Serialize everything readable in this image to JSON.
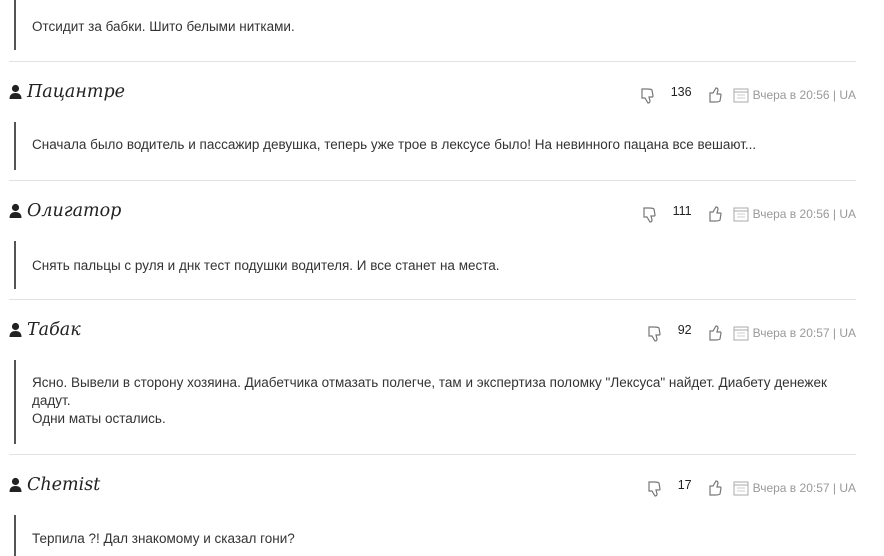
{
  "top_comment": {
    "text": "Отсидит за бабки. Шито белыми нитками."
  },
  "comments": [
    {
      "author": "Пацантре",
      "votes": "136",
      "date": "Вчера в 20:56 | UA",
      "text": [
        "Сначала было водитель и пассажир девушка, теперь уже трое в лексусе было! На невинного пацана все вешают..."
      ]
    },
    {
      "author": "Олигатор",
      "votes": "111",
      "date": "Вчера в 20:56 | UA",
      "text": [
        "Снять пальцы с руля и днк тест подушки водителя. И все станет на места."
      ]
    },
    {
      "author": "Табак",
      "votes": "92",
      "date": "Вчера в 20:57 | UA",
      "text": [
        "Ясно. Вывели в сторону хозяина. Диабетчика отмазать полегче, там и экспертиза поломку \"Лексуса\" найдет. Диабету денежек",
        "дадут.",
        "Одни маты остались."
      ]
    },
    {
      "author": "Chemist",
      "votes": "17",
      "date": "Вчера в 20:57 | UA",
      "text": [
        "Терпила ?! Дал знакомому и сказал гони?"
      ]
    }
  ],
  "icons": {
    "user": "user-icon",
    "dislike": "thumbs-down-icon",
    "like": "thumbs-up-icon",
    "date": "calendar-icon"
  }
}
